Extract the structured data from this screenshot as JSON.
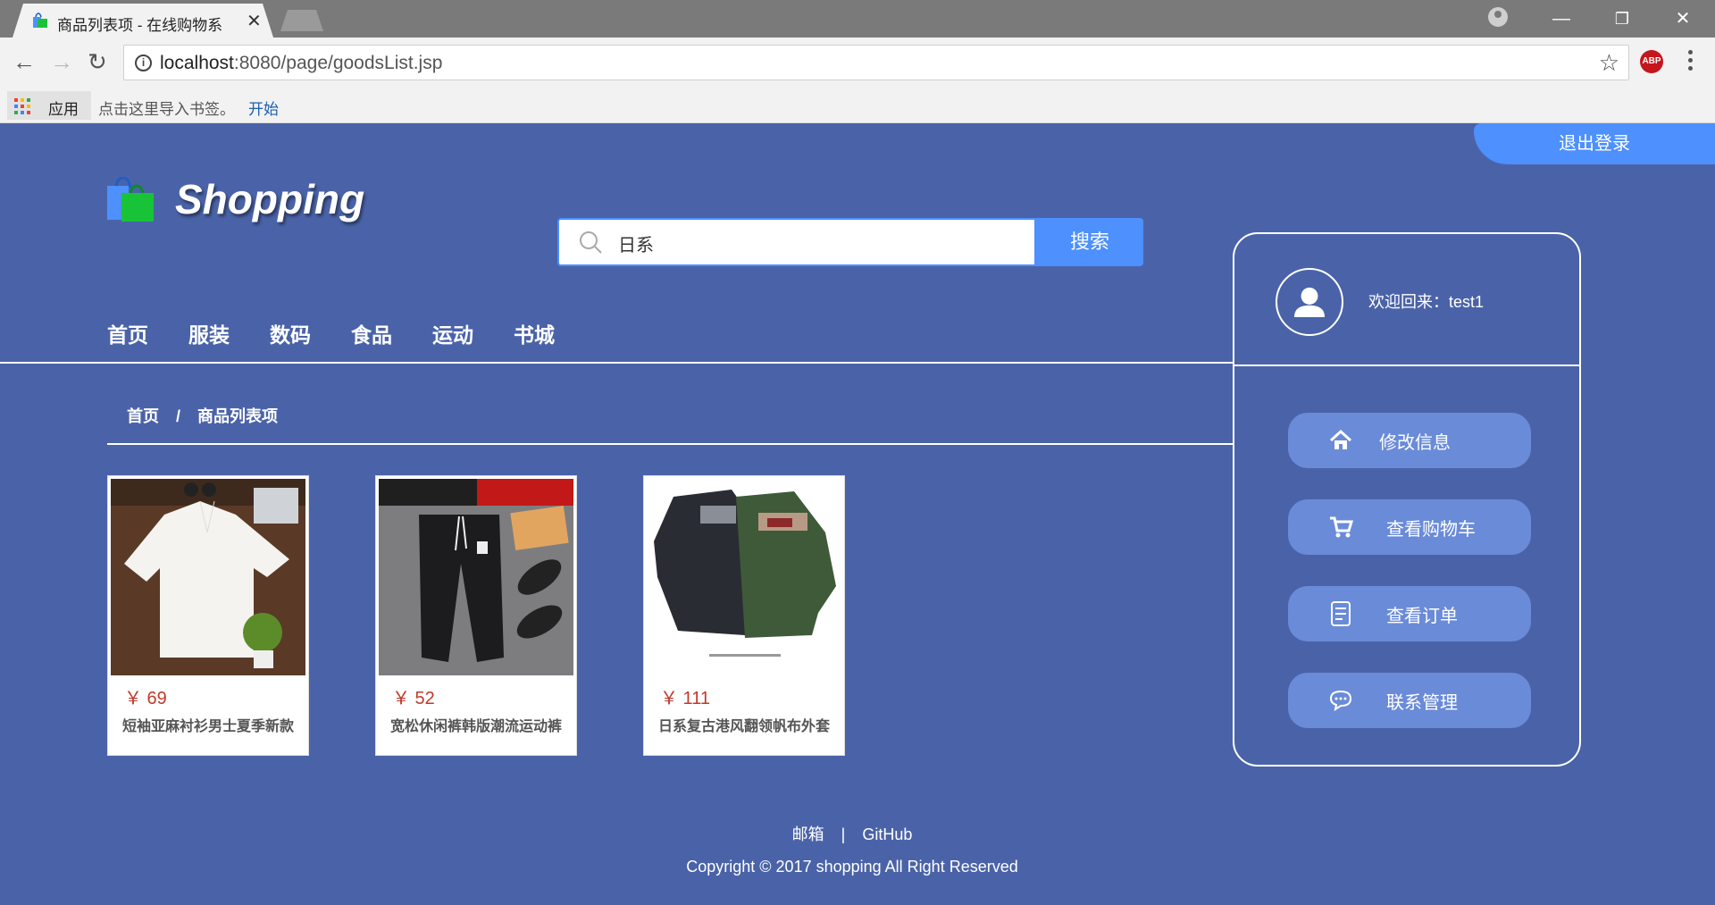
{
  "browser": {
    "tab_title": "商品列表项 - 在线购物系",
    "url_host": "localhost",
    "url_rest": ":8080/page/goodsList.jsp",
    "bookmarks": {
      "apps_label": "应用",
      "hint": "点击这里导入书签。",
      "start": "开始"
    },
    "icons": [
      "tab-favicon-icon",
      "close-icon",
      "back-icon",
      "forward-icon",
      "reload-icon",
      "info-icon",
      "star-icon",
      "abp-icon",
      "menu-icon",
      "profile-icon",
      "minimize-icon",
      "restore-icon",
      "window-close-icon"
    ],
    "abp_label": "ABP"
  },
  "header": {
    "logout": "退出登录",
    "logo_text": "Shopping",
    "search": {
      "value": "日系",
      "button": "搜索"
    },
    "nav": [
      "首页",
      "服装",
      "数码",
      "食品",
      "运动",
      "书城"
    ]
  },
  "breadcrumb": {
    "home": "首页",
    "sep": "/",
    "current": "商品列表项"
  },
  "products": [
    {
      "price": "￥ 69",
      "name": "短袖亚麻衬衫男士夏季新款"
    },
    {
      "price": "￥ 52",
      "name": "宽松休闲裤韩版潮流运动裤"
    },
    {
      "price": "￥ 111",
      "name": "日系复古港风翻领帆布外套"
    }
  ],
  "user_panel": {
    "welcome": "欢迎回来：test1",
    "buttons": [
      {
        "label": "修改信息",
        "icon": "home-icon"
      },
      {
        "label": "查看购物车",
        "icon": "cart-icon"
      },
      {
        "label": "查看订单",
        "icon": "order-icon"
      },
      {
        "label": "联系管理",
        "icon": "chat-icon"
      }
    ]
  },
  "footer": {
    "mail": "邮箱",
    "sep": "|",
    "github": "GitHub",
    "copyright": "Copyright © 2017 shopping All Right Reserved"
  },
  "colors": {
    "page_bg": "#4a63a8",
    "accent": "#4d90fe",
    "panel_button": "#6a8bd8",
    "price": "#c0392b"
  }
}
